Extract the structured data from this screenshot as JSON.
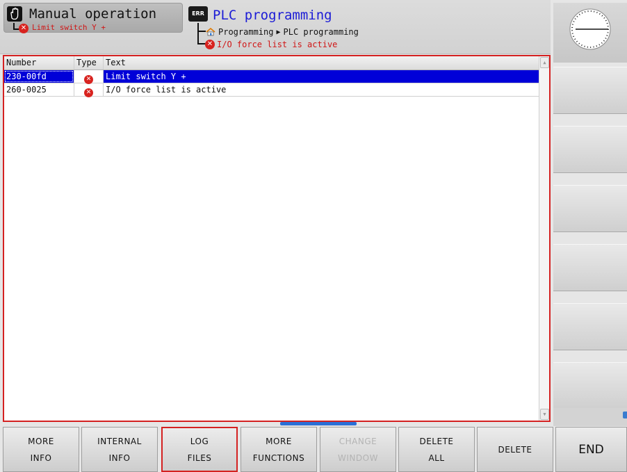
{
  "header": {
    "mode_title": "Manual operation",
    "mode_error": "Limit switch Y +",
    "err_badge": "ERR",
    "program_title": "PLC programming",
    "breadcrumb": [
      "Programming",
      "PLC programming"
    ],
    "program_error": "I/O force list is active",
    "icons": {
      "mode": "hand-icon",
      "error": "error-x-icon",
      "home": "home-icon",
      "arrow": "triangle-right-icon"
    }
  },
  "clock": {
    "icon": "analog-clock-icon"
  },
  "table": {
    "columns": [
      "Number",
      "Type",
      "Text"
    ],
    "rows": [
      {
        "number": "230-00fd",
        "type": "error",
        "text": "Limit switch Y +",
        "selected": true
      },
      {
        "number": "260-0025",
        "type": "error",
        "text": "I/O force list is active",
        "selected": false
      }
    ]
  },
  "softkeys": [
    {
      "line1": "MORE",
      "line2": "INFO",
      "enabled": true,
      "active": false
    },
    {
      "line1": "INTERNAL",
      "line2": "INFO",
      "enabled": true,
      "active": false
    },
    {
      "line1": "LOG",
      "line2": "FILES",
      "enabled": true,
      "active": true
    },
    {
      "line1": "MORE",
      "line2": "FUNCTIONS",
      "enabled": true,
      "active": false
    },
    {
      "line1": "CHANGE",
      "line2": "WINDOW",
      "enabled": false,
      "active": false
    },
    {
      "line1": "DELETE",
      "line2": "ALL",
      "enabled": true,
      "active": false
    },
    {
      "line1": "DELETE",
      "line2": "",
      "enabled": true,
      "active": false
    },
    {
      "line1": "END",
      "line2": "",
      "enabled": true,
      "active": false
    }
  ],
  "colors": {
    "frame_red": "#d42121",
    "selection_blue": "#0000d8",
    "error_red": "#d8231f",
    "title_blue": "#1c1cd6"
  }
}
